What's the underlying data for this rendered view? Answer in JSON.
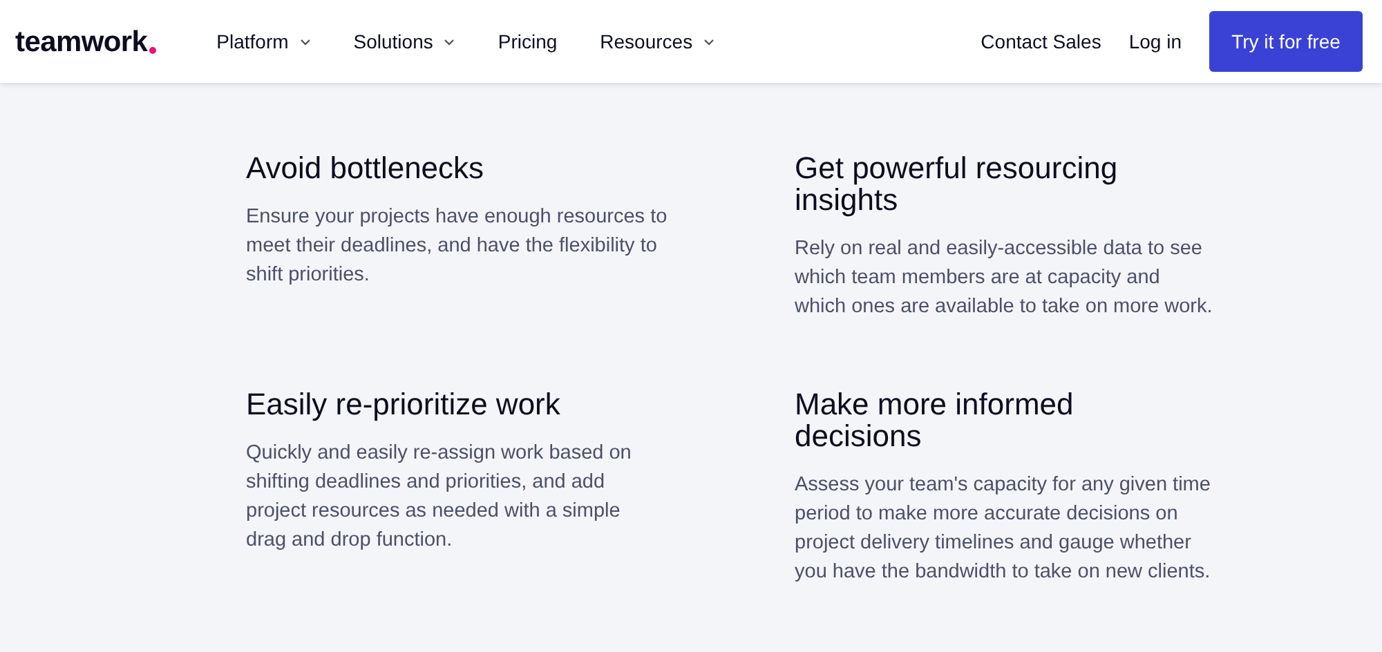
{
  "header": {
    "logo": "teamwork",
    "nav": [
      {
        "label": "Platform",
        "has_menu": true
      },
      {
        "label": "Solutions",
        "has_menu": true
      },
      {
        "label": "Pricing",
        "has_menu": false
      },
      {
        "label": "Resources",
        "has_menu": true
      }
    ],
    "links": [
      "Contact Sales",
      "Log in"
    ],
    "cta": "Try it for free"
  },
  "features": [
    {
      "title": [
        "Avoid bottlenecks"
      ],
      "text": [
        "Ensure your projects have enough resources to",
        "meet their deadlines, and have the flexibility to",
        "shift priorities."
      ]
    },
    {
      "title": [
        "Get powerful resourcing",
        "insights"
      ],
      "text": [
        "Rely on real and easily-accessible data to see",
        "which team members are at capacity and",
        "which ones are available to take on more work."
      ]
    },
    {
      "title": [
        "Easily re-prioritize work"
      ],
      "text": [
        "Quickly and easily re-assign work based on",
        "shifting deadlines and priorities, and add",
        "project resources as needed with a simple",
        "drag and drop function."
      ]
    },
    {
      "title": [
        "Make more informed",
        "decisions"
      ],
      "text": [
        "Assess your team's capacity for any given time",
        "period to make more accurate decisions on",
        "project delivery timelines and gauge whether",
        "you have the bandwidth to take on new clients."
      ]
    }
  ]
}
